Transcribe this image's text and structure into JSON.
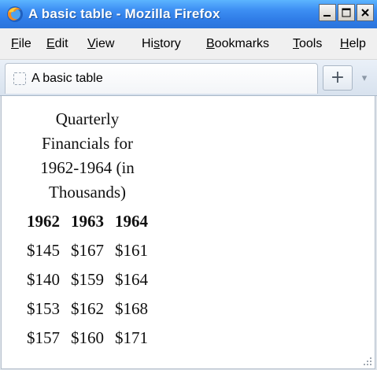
{
  "window": {
    "title": "A basic table - Mozilla Firefox",
    "app_icon": "firefox-icon",
    "buttons": {
      "minimize_icon": "minimize-icon",
      "maximize_icon": "maximize-icon",
      "close_icon": "close-icon"
    }
  },
  "menubar": {
    "items": [
      {
        "label": "File",
        "mnemonic": "F",
        "rest": "ile"
      },
      {
        "label": "Edit",
        "mnemonic": "E",
        "rest": "dit"
      },
      {
        "label": "View",
        "mnemonic": "V",
        "rest": "iew"
      },
      {
        "label": "History",
        "pre": "Hi",
        "mnemonic": "s",
        "rest": "tory"
      },
      {
        "label": "Bookmarks",
        "mnemonic": "B",
        "rest": "ookmarks"
      },
      {
        "label": "Tools",
        "mnemonic": "T",
        "rest": "ools"
      },
      {
        "label": "Help",
        "mnemonic": "H",
        "rest": "elp"
      }
    ]
  },
  "tabs": [
    {
      "label": "A basic table",
      "icon": "blank-page-icon",
      "active": true
    }
  ],
  "tabstrip": {
    "new_tab_symbol": "+",
    "list_all_tabs_symbol": "▾"
  },
  "page": {
    "caption": "Quarterly Financials for 1962-1964 (in Thousands)",
    "headers": [
      "1962",
      "1963",
      "1964"
    ],
    "rows": [
      [
        "$145",
        "$167",
        "$161"
      ],
      [
        "$140",
        "$159",
        "$164"
      ],
      [
        "$153",
        "$162",
        "$168"
      ],
      [
        "$157",
        "$160",
        "$171"
      ]
    ]
  },
  "colors": {
    "titlebar": "#2f7ce7",
    "menubar": "#f0f0f0",
    "tabstrip": "#dfe6ef",
    "content": "#ffffff"
  }
}
